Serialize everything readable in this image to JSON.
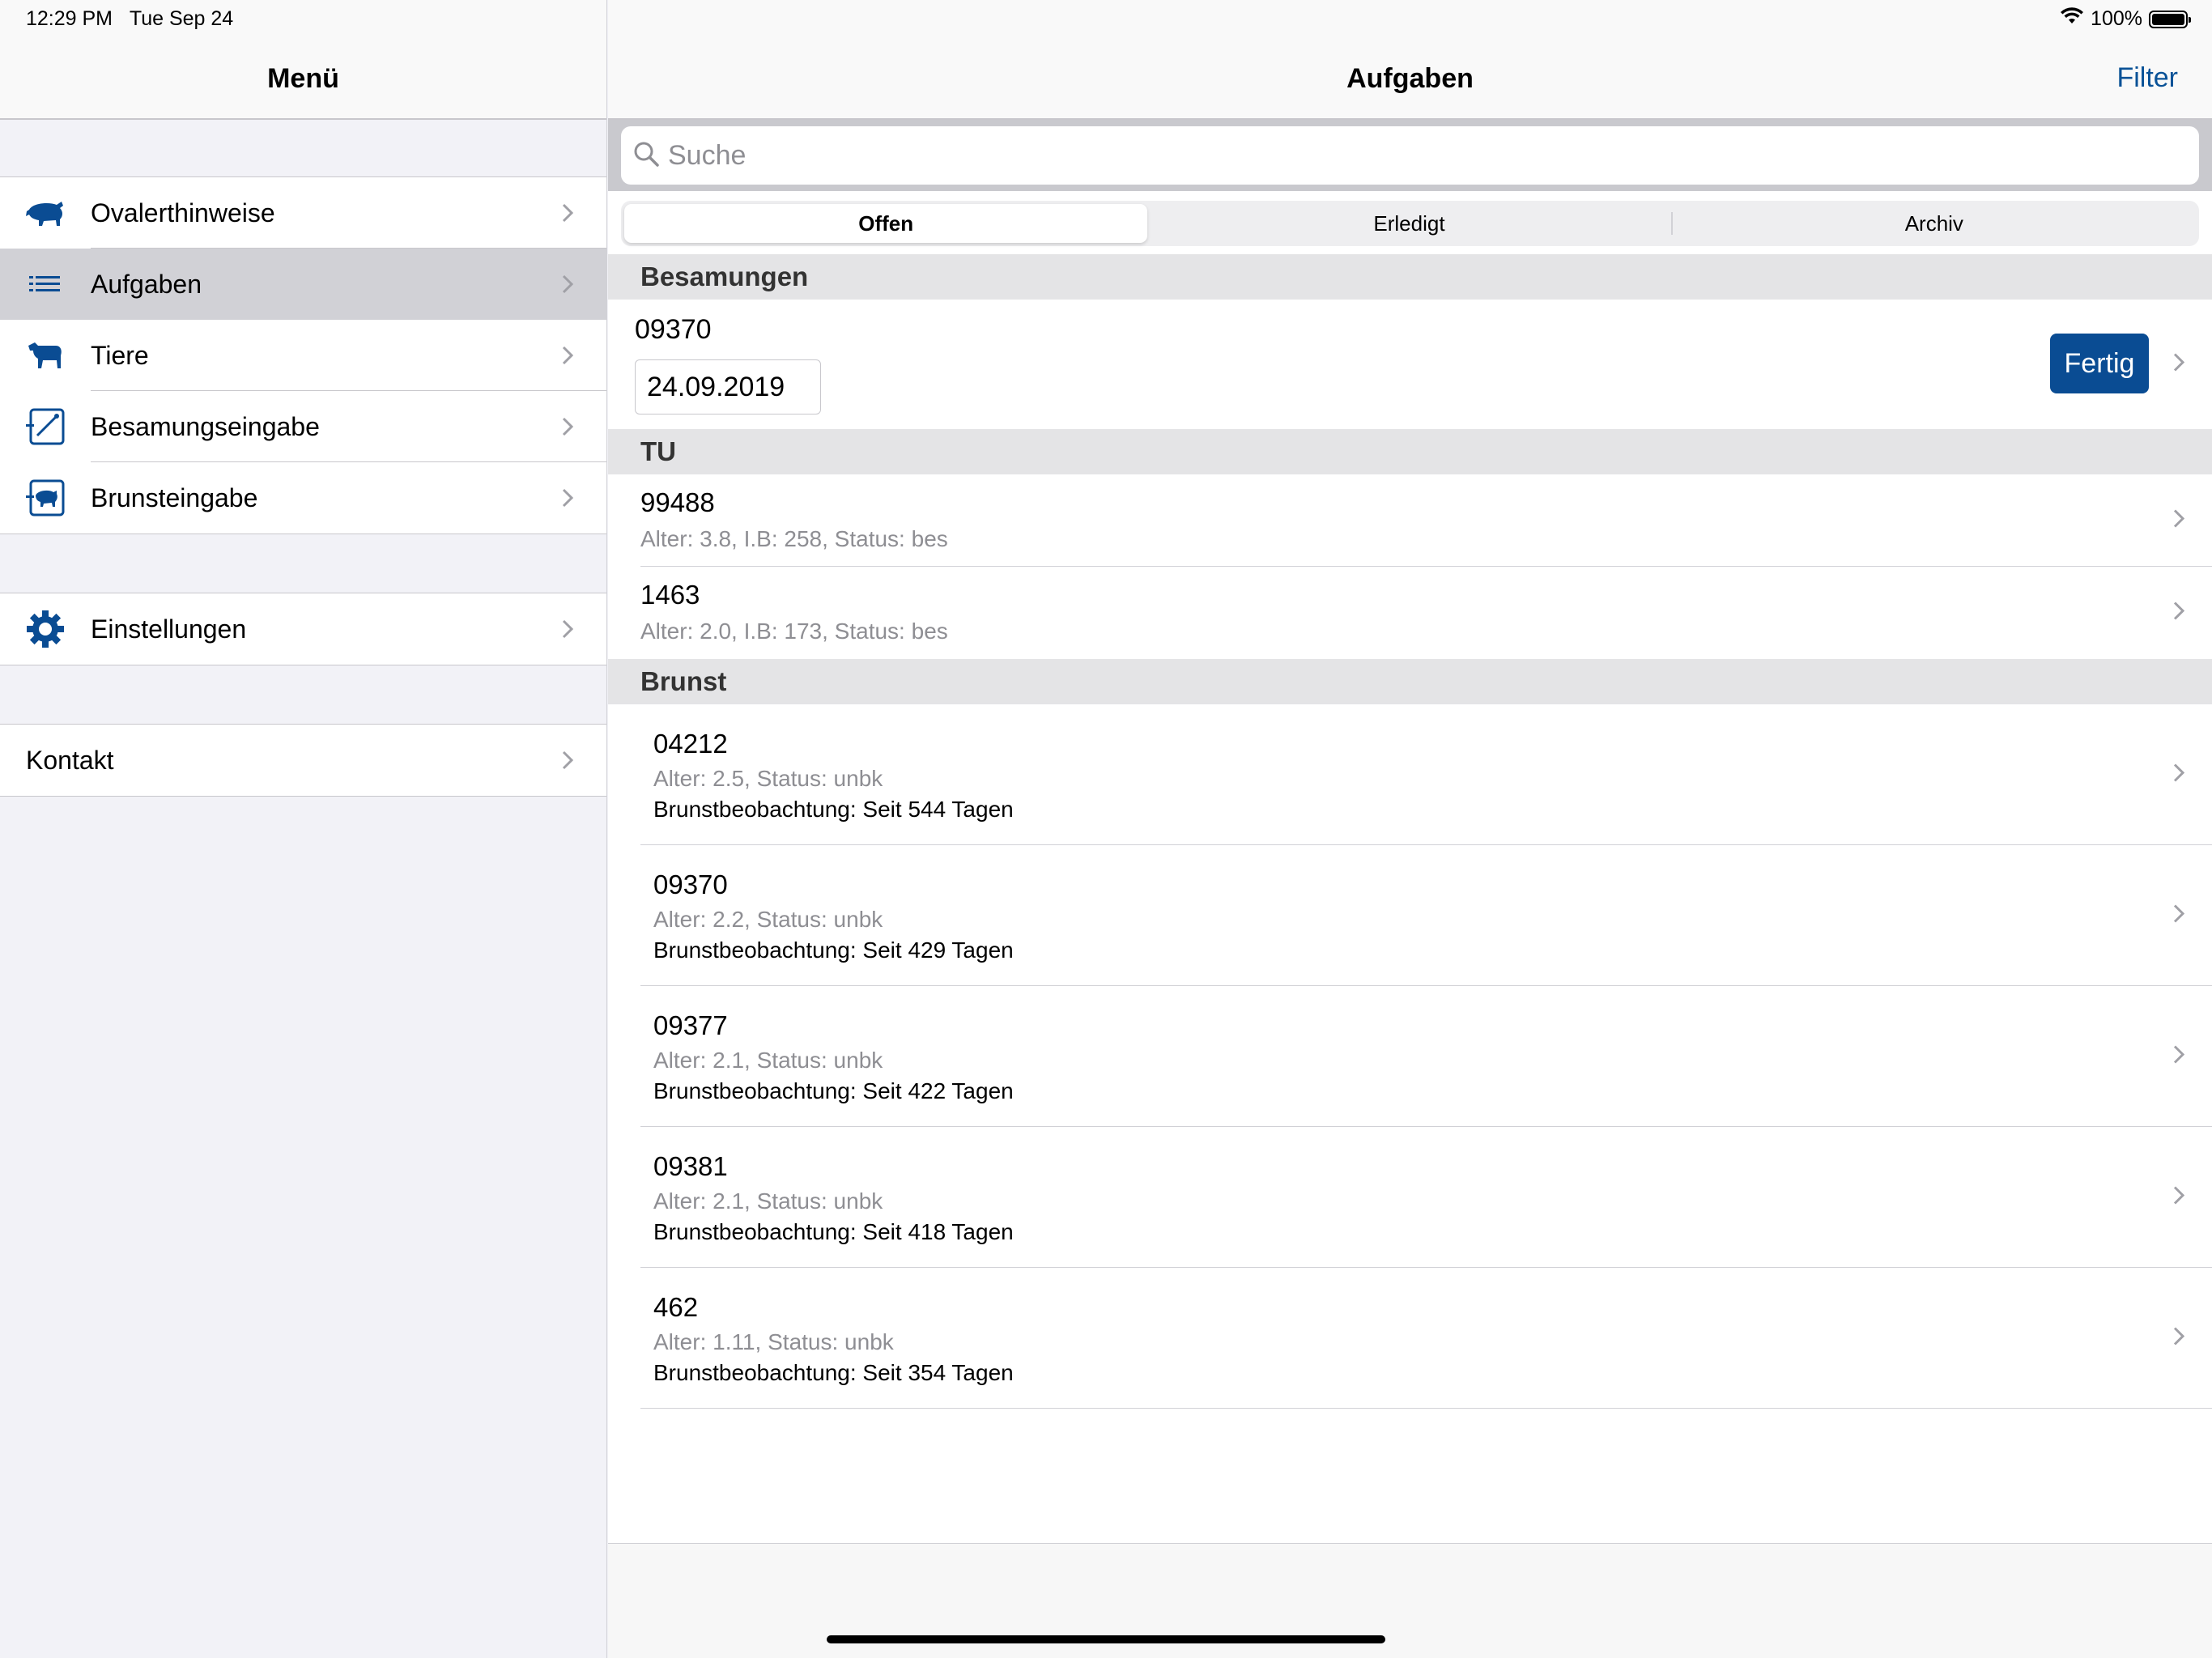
{
  "status_bar": {
    "time": "12:29 PM",
    "date": "Tue Sep 24",
    "battery": "100%"
  },
  "sidebar": {
    "title": "Menü",
    "items": [
      {
        "label": "Ovalerthinweise",
        "icon": "bull-icon"
      },
      {
        "label": "Aufgaben",
        "icon": "list-icon",
        "selected": true
      },
      {
        "label": "Tiere",
        "icon": "cow-icon"
      },
      {
        "label": "Besamungseingabe",
        "icon": "insemination-icon"
      },
      {
        "label": "Brunsteingabe",
        "icon": "heat-entry-icon"
      }
    ],
    "settings": {
      "label": "Einstellungen",
      "icon": "gear-icon"
    },
    "contact": {
      "label": "Kontakt"
    }
  },
  "main": {
    "title": "Aufgaben",
    "filter_label": "Filter",
    "search": {
      "placeholder": "Suche",
      "value": ""
    },
    "segments": [
      "Offen",
      "Erledigt",
      "Archiv"
    ],
    "active_segment": "Offen",
    "sections": {
      "besamungen": {
        "header": "Besamungen",
        "item": {
          "id": "09370",
          "date": "24.09.2019",
          "button": "Fertig"
        }
      },
      "tu": {
        "header": "TU",
        "items": [
          {
            "id": "99488",
            "details": "Alter: 3.8, I.B: 258, Status: bes"
          },
          {
            "id": "1463",
            "details": "Alter: 2.0, I.B: 173, Status: bes"
          }
        ]
      },
      "brunst": {
        "header": "Brunst",
        "items": [
          {
            "id": "04212",
            "details": "Alter: 2.5, Status: unbk",
            "observation": "Brunstbeobachtung: Seit 544 Tagen"
          },
          {
            "id": "09370",
            "details": "Alter: 2.2, Status: unbk",
            "observation": "Brunstbeobachtung: Seit 429 Tagen"
          },
          {
            "id": "09377",
            "details": "Alter: 2.1, Status: unbk",
            "observation": "Brunstbeobachtung: Seit 422 Tagen"
          },
          {
            "id": "09381",
            "details": "Alter: 2.1, Status: unbk",
            "observation": "Brunstbeobachtung: Seit 418 Tagen"
          },
          {
            "id": "462",
            "details": "Alter: 1.11, Status: unbk",
            "observation": "Brunstbeobachtung: Seit 354 Tagen"
          }
        ]
      }
    }
  },
  "colors": {
    "accent": "#0a4c93",
    "link": "#0a5297",
    "selected_row": "#d1d1d6",
    "section_bg": "#e4e4e6"
  }
}
